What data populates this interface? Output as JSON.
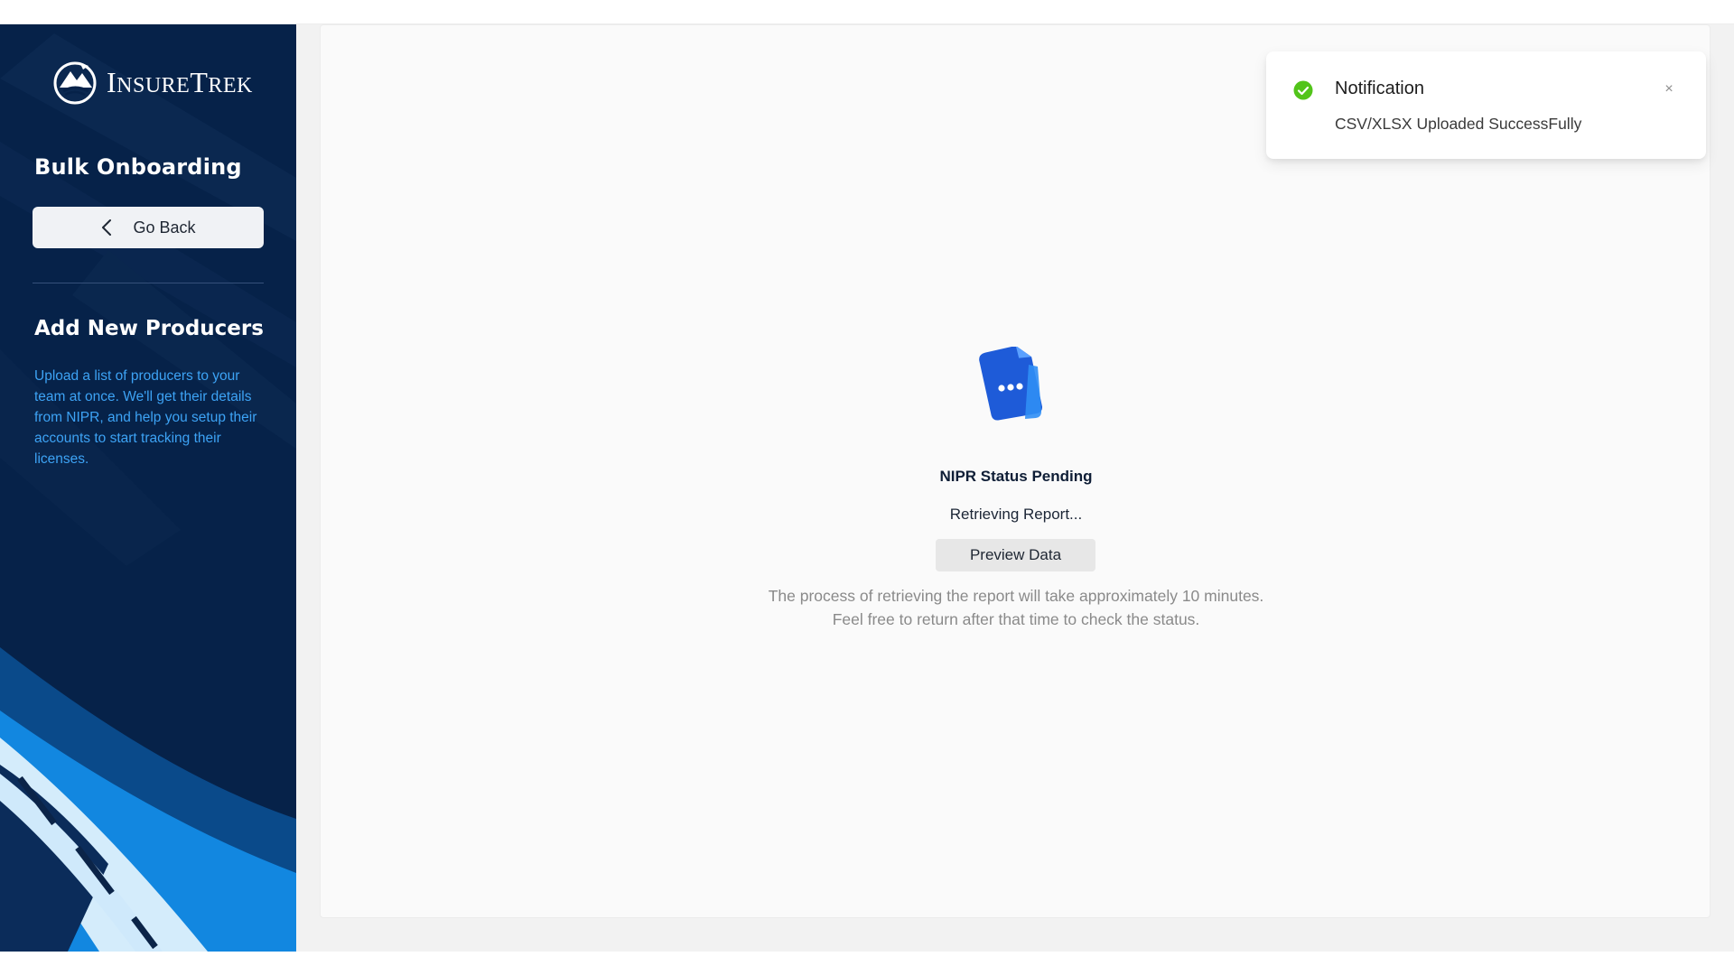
{
  "brand": {
    "logo_text_first": "I",
    "logo_text_small": "NSURE",
    "logo_text_second": "T",
    "logo_text_small2": "REK"
  },
  "sidebar": {
    "title": "Bulk Onboarding",
    "go_back_label": "Go Back",
    "section_title": "Add New Producers",
    "section_description": "Upload a list of producers to your team at once. We'll get their details from NIPR, and help you setup their accounts to start tracking their licenses."
  },
  "main": {
    "status_title": "NIPR Status Pending",
    "status_subtitle": "Retrieving Report...",
    "preview_button_label": "Preview Data",
    "info_line_1": "The process of retrieving the report will take approximately 10 minutes.",
    "info_line_2": "Feel free to return after that time to check the status."
  },
  "notification": {
    "title": "Notification",
    "message": "CSV/XLSX Uploaded SuccessFully",
    "close_glyph": "×",
    "status_color": "#52c41a"
  },
  "colors": {
    "sidebar_bg": "#062249",
    "accent_blue": "#1677ff",
    "description_blue": "#3da3f5"
  }
}
